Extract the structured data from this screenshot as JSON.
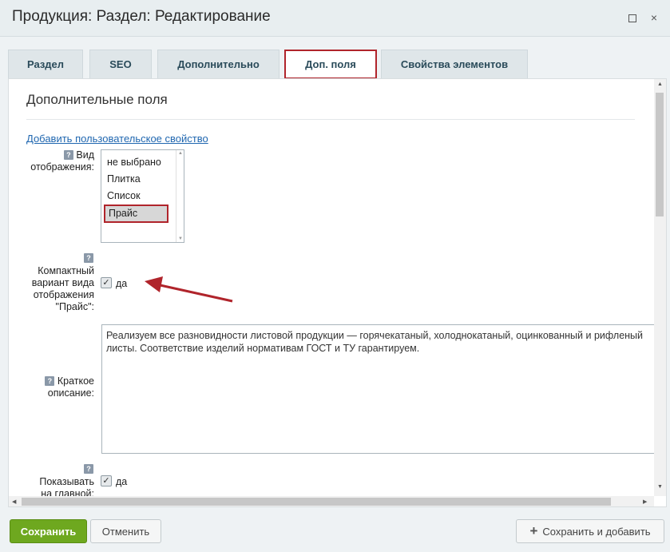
{
  "window": {
    "title": "Продукция: Раздел: Редактирование",
    "maximize_icon": "maximize-icon",
    "close_icon": "close-icon",
    "close_glyph": "×"
  },
  "tabs": [
    {
      "label": "Раздел"
    },
    {
      "label": "SEO"
    },
    {
      "label": "Дополнительно"
    },
    {
      "label": "Доп. поля",
      "active": true
    },
    {
      "label": "Свойства элементов"
    }
  ],
  "main": {
    "section_title": "Дополнительные поля",
    "add_link": "Добавить пользовательское свойство",
    "help_glyph": "?",
    "view_mode": {
      "label_line1": "Вид",
      "label_line2": "отображения:",
      "options": [
        "не выбрано",
        "Плитка",
        "Список",
        "Прайс"
      ],
      "selected": "Прайс"
    },
    "compact": {
      "label_lines": [
        "Компактный",
        "вариант вида",
        "отображения",
        "\"Прайс\":"
      ],
      "checked": true,
      "check_label": "да"
    },
    "short_desc": {
      "label_line1": "Краткое",
      "label_line2": "описание:",
      "value": "Реализуем все разновидности листовой продукции — горячекатаный, холоднокатаный, оцинкованный и рифленый\nлисты. Соответствие изделий нормативам ГОСТ и ТУ гарантируем."
    },
    "show_main": {
      "label_lines": [
        "Показывать",
        "на главной:"
      ],
      "checked": true,
      "check_label": "да"
    },
    "check_glyph": "✓",
    "annotation_color": "#b0242b"
  },
  "footer": {
    "save_label": "Сохранить",
    "cancel_label": "Отменить",
    "save_add_label": "Сохранить и добавить",
    "plus_glyph": "+"
  },
  "colors": {
    "accent": "#6ea81f",
    "highlight": "#b0242b",
    "link": "#2067b0"
  }
}
